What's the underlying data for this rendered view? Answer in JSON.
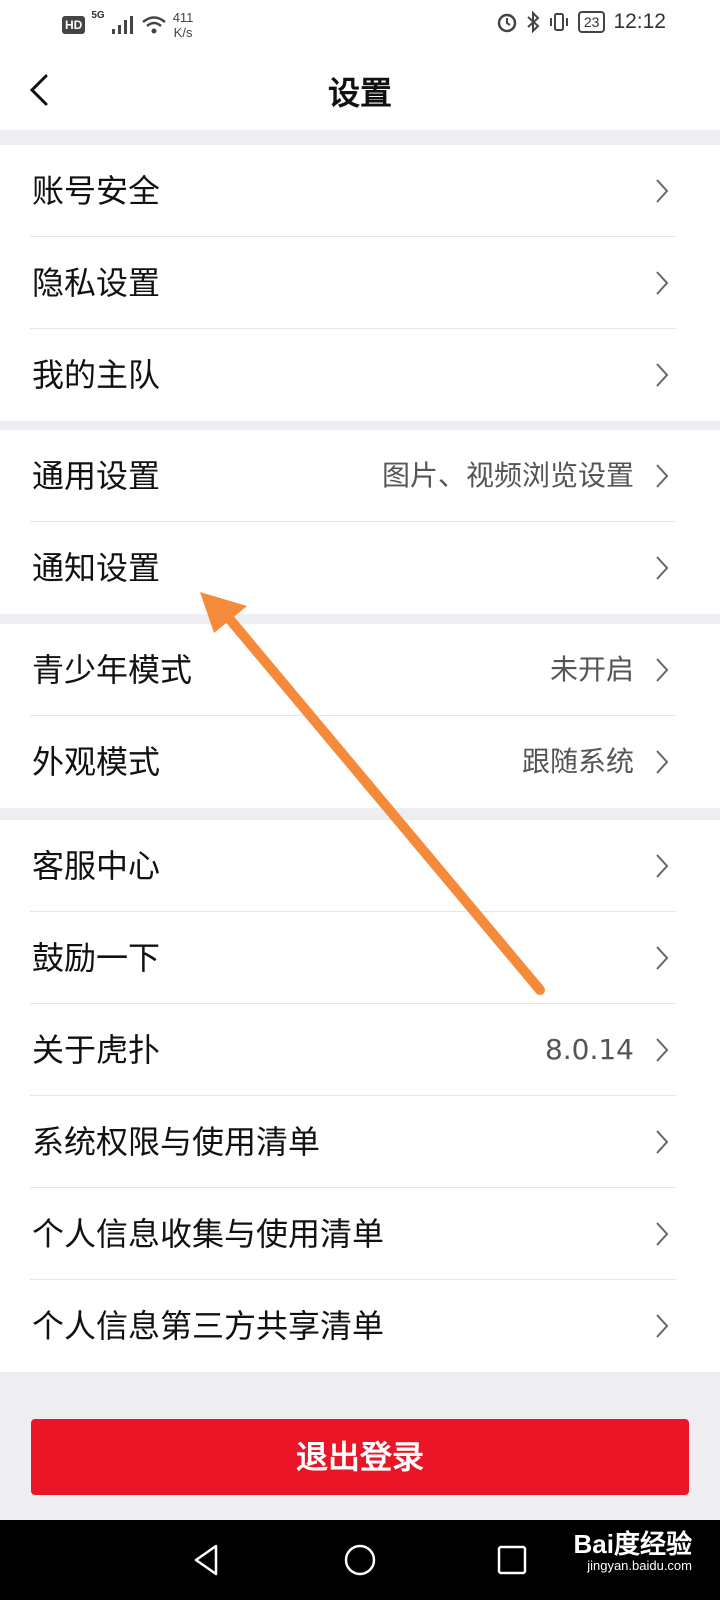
{
  "status_bar": {
    "hd": "HD",
    "network": "5G",
    "net_speed_value": "411",
    "net_speed_unit": "K/s",
    "battery": "23",
    "time": "12:12"
  },
  "header": {
    "title": "设置"
  },
  "groups": [
    [
      {
        "label": "账号安全",
        "value": ""
      },
      {
        "label": "隐私设置",
        "value": ""
      },
      {
        "label": "我的主队",
        "value": ""
      }
    ],
    [
      {
        "label": "通用设置",
        "value": "图片、视频浏览设置"
      },
      {
        "label": "通知设置",
        "value": ""
      }
    ],
    [
      {
        "label": "青少年模式",
        "value": "未开启"
      },
      {
        "label": "外观模式",
        "value": "跟随系统"
      }
    ],
    [
      {
        "label": "客服中心",
        "value": ""
      },
      {
        "label": "鼓励一下",
        "value": ""
      },
      {
        "label": "关于虎扑",
        "value": "8.0.14"
      },
      {
        "label": "系统权限与使用清单",
        "value": ""
      },
      {
        "label": "个人信息收集与使用清单",
        "value": ""
      },
      {
        "label": "个人信息第三方共享清单",
        "value": ""
      }
    ]
  ],
  "logout_label": "退出登录",
  "watermark": {
    "brand": "Bai度经验",
    "url": "jingyan.baidu.com"
  },
  "colors": {
    "logout": "#ea1527",
    "annotation_arrow": "#f58a3a"
  },
  "icons": [
    "back-chevron-icon",
    "chevron-right-icon",
    "back-triangle-icon",
    "home-circle-icon",
    "recents-square-icon"
  ]
}
